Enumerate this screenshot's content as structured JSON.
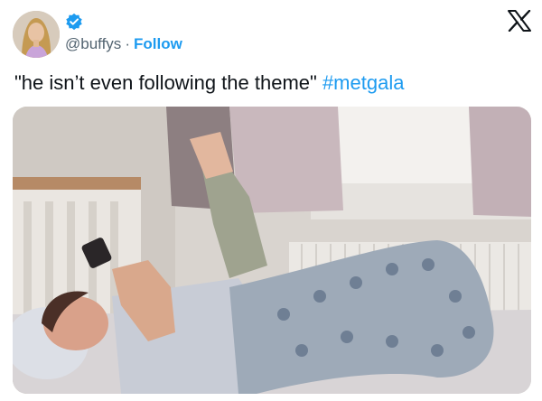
{
  "tweet": {
    "handle": "@buffys",
    "separator": "·",
    "follow_label": "Follow",
    "text_quote": "\"he isn’t even following the theme\" ",
    "hashtag": "#metgala"
  },
  "icons": {
    "verified": "verified-badge-icon",
    "platform_logo": "x-logo-icon"
  },
  "colors": {
    "text": "#0f1419",
    "secondary": "#536471",
    "accent": "#1d9bf0"
  }
}
